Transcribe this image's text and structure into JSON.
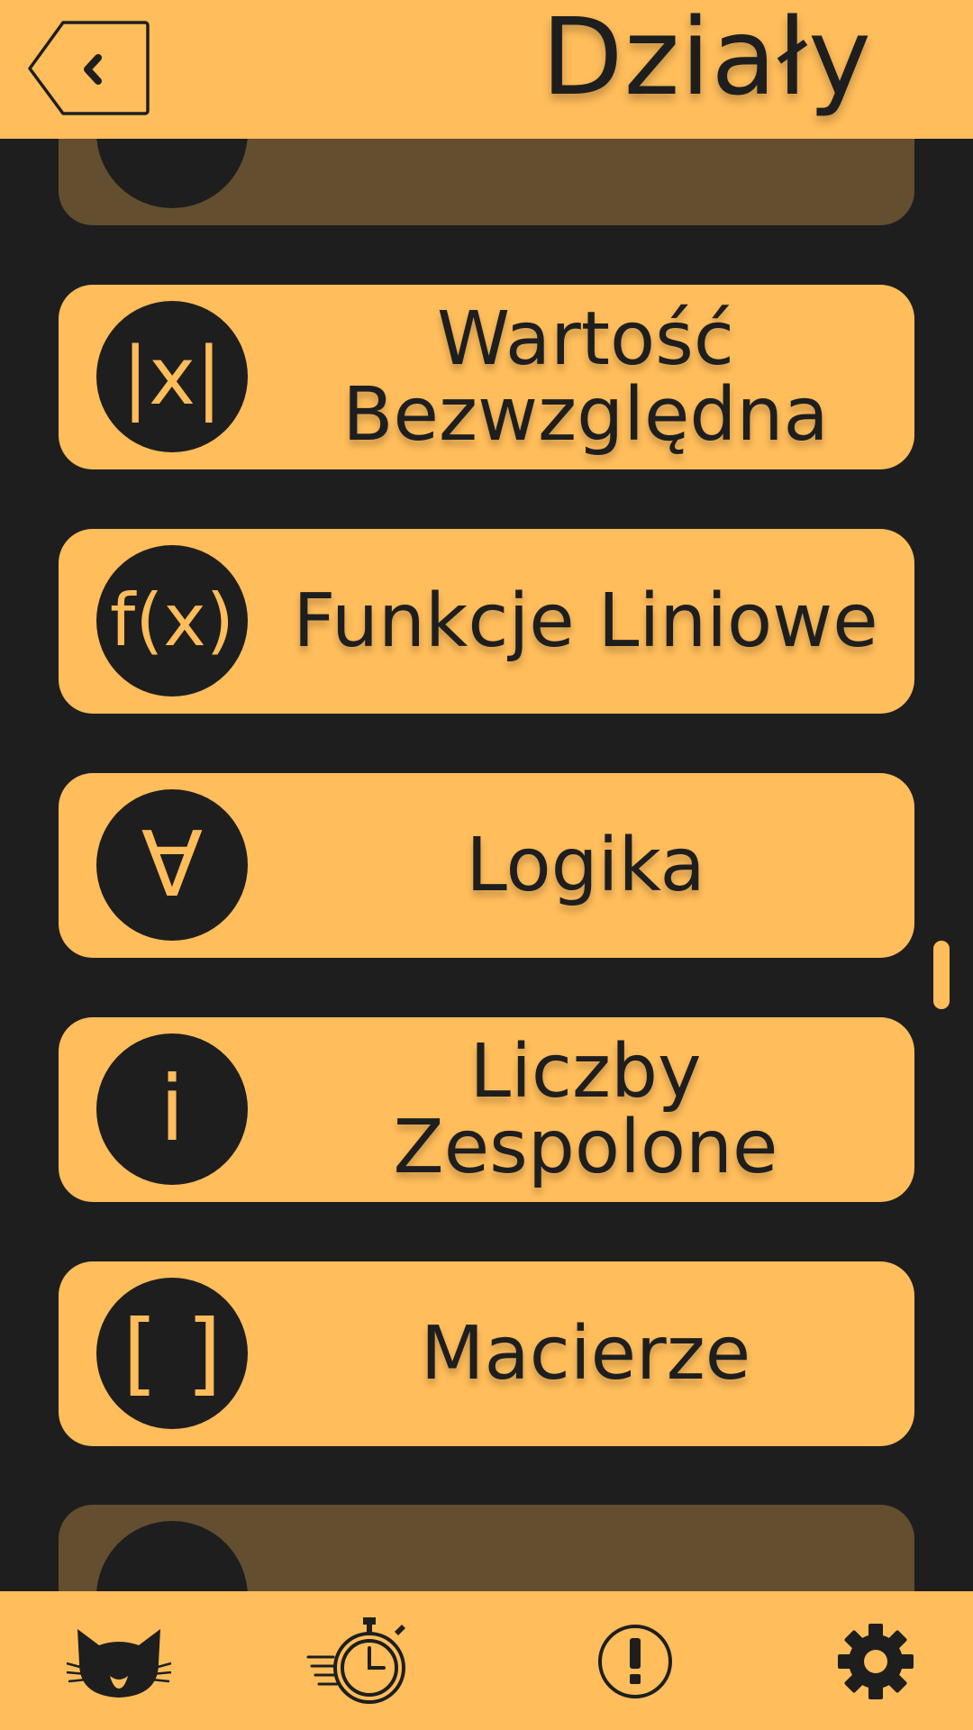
{
  "header": {
    "title": "Działy",
    "back_icon": "back-chevron-icon"
  },
  "sections": [
    {
      "label_lines": [
        "",
        ""
      ],
      "icon_text": "",
      "state": "partially-visible"
    },
    {
      "label_lines": [
        "Wartość",
        "Bezwzględna"
      ],
      "icon_text": "|x|"
    },
    {
      "label_lines": [
        "Funkcje Liniowe",
        ""
      ],
      "icon_text": "f(x)"
    },
    {
      "label_lines": [
        "Logika",
        ""
      ],
      "icon_text": "∀"
    },
    {
      "label_lines": [
        "Liczby",
        "Zespolone"
      ],
      "icon_text": "i"
    },
    {
      "label_lines": [
        "Macierze",
        ""
      ],
      "icon_text": "[ ]"
    },
    {
      "label_lines": [
        "",
        ""
      ],
      "icon_text": "",
      "state": "partially-visible"
    }
  ],
  "bottom_nav": {
    "items": [
      {
        "icon": "cat-icon"
      },
      {
        "icon": "stopwatch-icon"
      },
      {
        "icon": "exclamation-icon"
      },
      {
        "icon": "gear-icon"
      }
    ]
  },
  "colors": {
    "accent": "#ffbd5b",
    "background": "#1e1e1e",
    "dim_card": "#634e30"
  }
}
